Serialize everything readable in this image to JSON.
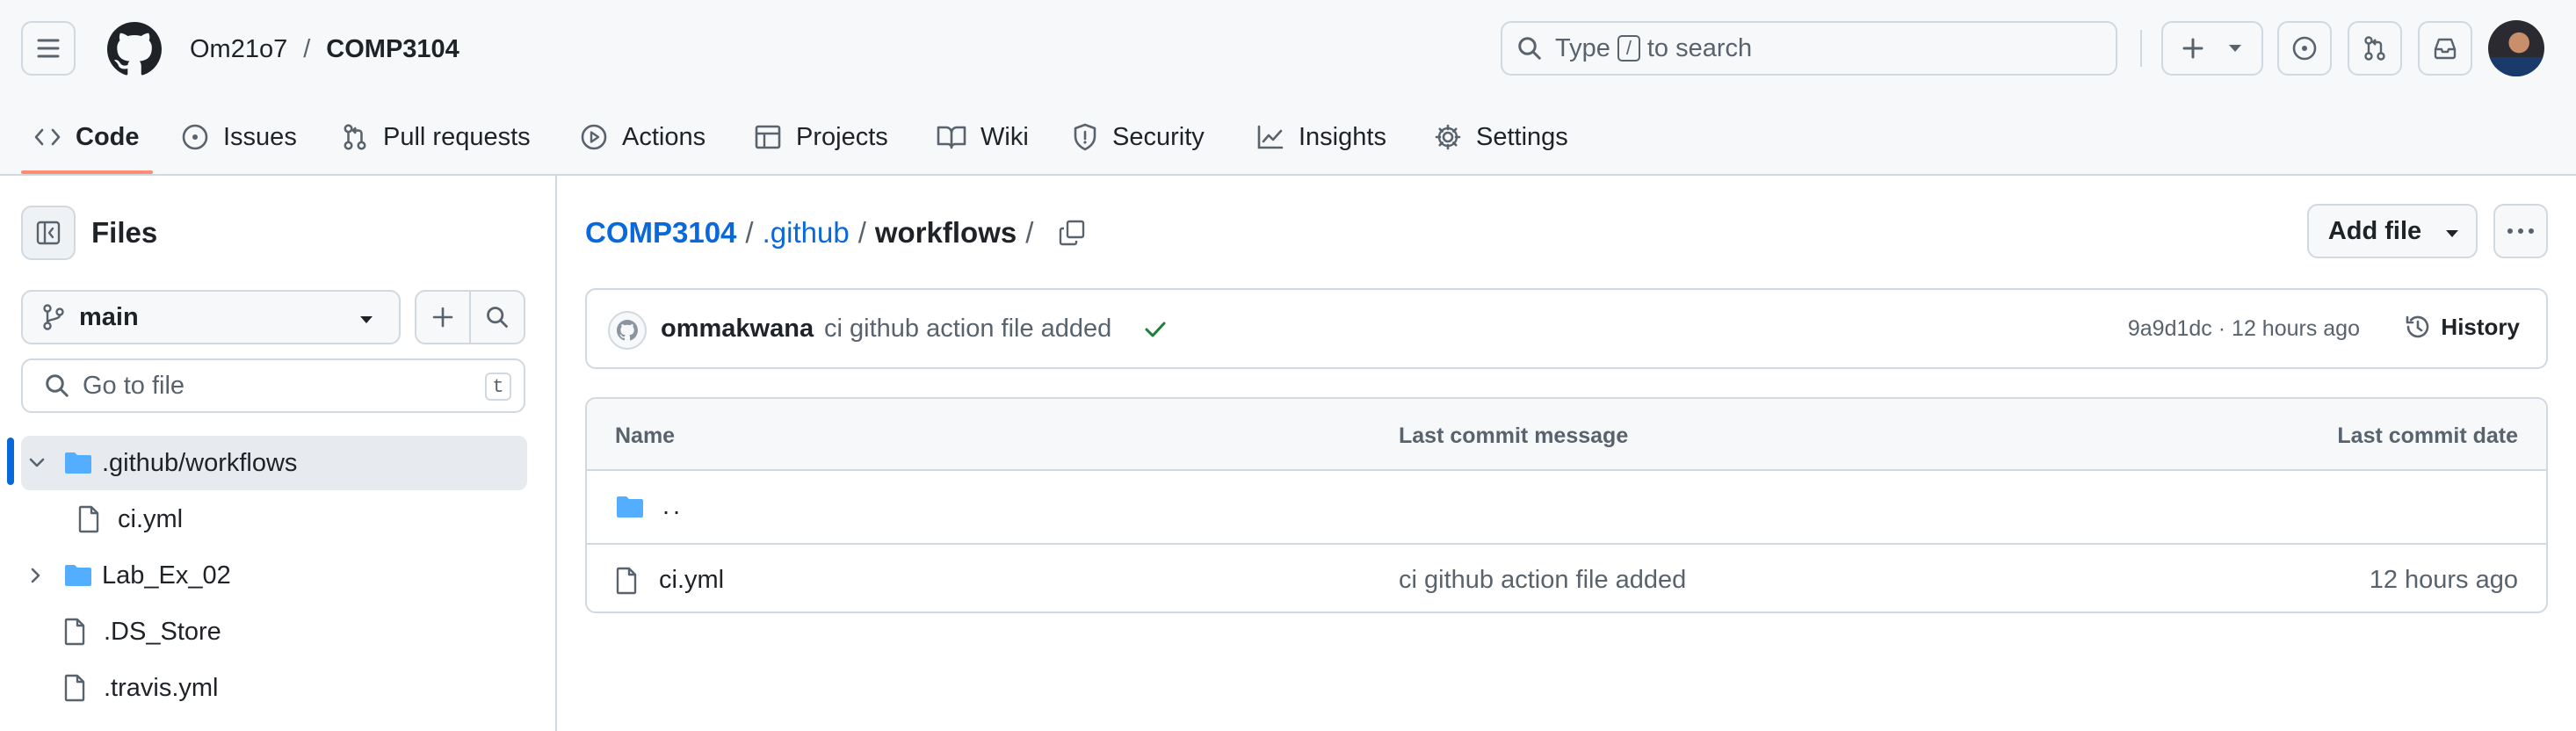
{
  "header": {
    "owner": "Om21o7",
    "separator": "/",
    "repo": "COMP3104",
    "search": {
      "prefix": "Type",
      "key": "/",
      "suffix": "to search"
    }
  },
  "repo_nav": {
    "items": [
      {
        "label": "Code",
        "icon": "code-icon",
        "active": true
      },
      {
        "label": "Issues",
        "icon": "issue-icon"
      },
      {
        "label": "Pull requests",
        "icon": "pull-request-icon"
      },
      {
        "label": "Actions",
        "icon": "play-icon"
      },
      {
        "label": "Projects",
        "icon": "table-icon"
      },
      {
        "label": "Wiki",
        "icon": "book-icon"
      },
      {
        "label": "Security",
        "icon": "shield-icon"
      },
      {
        "label": "Insights",
        "icon": "graph-icon"
      },
      {
        "label": "Settings",
        "icon": "gear-icon"
      }
    ]
  },
  "sidebar": {
    "title": "Files",
    "branch": "main",
    "go_to_file": {
      "placeholder": "Go to file",
      "shortcut": "t"
    },
    "tree": [
      {
        "label": ".github/workflows",
        "type": "folder",
        "expanded": true,
        "selected": true
      },
      {
        "label": "ci.yml",
        "type": "file",
        "indent": 1
      },
      {
        "label": "Lab_Ex_02",
        "type": "folder",
        "expanded": false
      },
      {
        "label": ".DS_Store",
        "type": "file"
      },
      {
        "label": ".travis.yml",
        "type": "file"
      }
    ]
  },
  "main": {
    "breadcrumb": {
      "repo": "COMP3104",
      "dir": ".github",
      "current": "workflows",
      "sep": "/"
    },
    "add_file_label": "Add file",
    "commit": {
      "author": "ommakwana",
      "message": "ci github action file added",
      "sha": "9a9d1dc",
      "time": "12 hours ago",
      "meta_sep": "·",
      "history_label": "History"
    },
    "table": {
      "headers": {
        "name": "Name",
        "message": "Last commit message",
        "date": "Last commit date"
      },
      "rows": [
        {
          "name": "..",
          "type": "parent",
          "message": "",
          "date": ""
        },
        {
          "name": "ci.yml",
          "type": "file",
          "message": "ci github action file added",
          "date": "12 hours ago"
        }
      ]
    }
  },
  "colors": {
    "accent_link": "#0969da",
    "nav_underline": "#fd8c73",
    "folder": "#54aeff",
    "success": "#1a7f37",
    "border": "#d1d9e0",
    "muted": "#59636e"
  }
}
